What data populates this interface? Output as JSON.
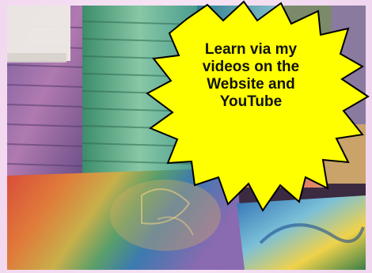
{
  "callout": {
    "lines": [
      "Learn via my",
      "videos on the",
      "Website and",
      "YouTube"
    ],
    "fill_color": "#ffff00",
    "outline_color": "#000000"
  },
  "photo": {
    "subject": "stacks of hand-dyed fabrics"
  },
  "colors": {
    "frame": "#f3d9f0"
  }
}
